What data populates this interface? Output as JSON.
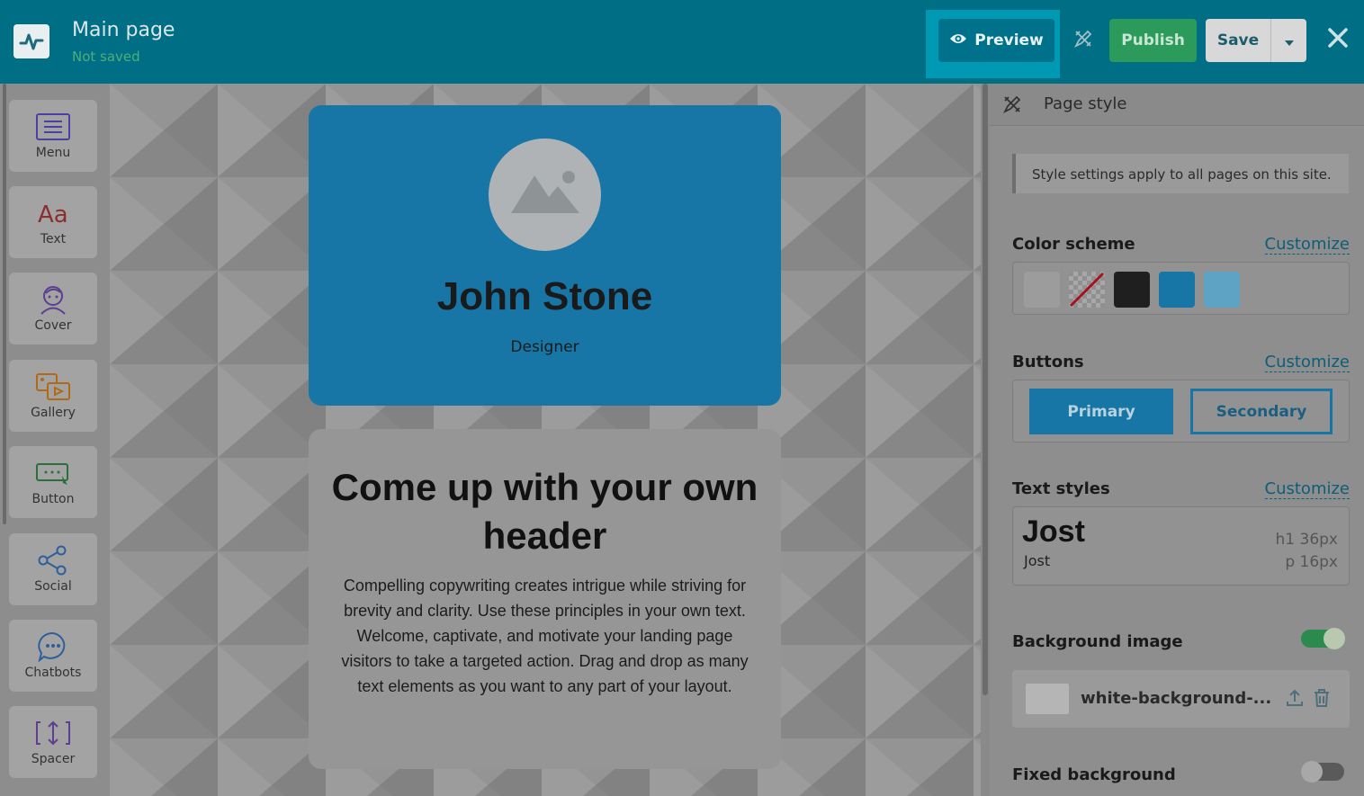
{
  "header": {
    "page_title": "Main page",
    "status": "Not saved",
    "preview_label": "Preview",
    "publish_label": "Publish",
    "save_label": "Save"
  },
  "toolbar": {
    "items": [
      {
        "label": "Menu",
        "icon": "menu-icon"
      },
      {
        "label": "Text",
        "icon": "text-icon"
      },
      {
        "label": "Cover",
        "icon": "cover-icon"
      },
      {
        "label": "Gallery",
        "icon": "gallery-icon"
      },
      {
        "label": "Button",
        "icon": "button-icon"
      },
      {
        "label": "Social",
        "icon": "social-icon"
      },
      {
        "label": "Chatbots",
        "icon": "chatbots-icon"
      },
      {
        "label": "Spacer",
        "icon": "spacer-icon"
      }
    ]
  },
  "canvas": {
    "hero": {
      "name": "John Stone",
      "role": "Designer"
    },
    "text_block": {
      "header": "Come up with your own header",
      "body": "Compelling copywriting creates intrigue while striving for brevity and clarity. Use these principles in your own text. Welcome, captivate, and motivate your landing page visitors to take a targeted action. Drag and drop as many text elements as you want to any part of your layout."
    }
  },
  "panel": {
    "title": "Page style",
    "info": "Style settings apply to all pages on this site.",
    "color_scheme": {
      "title": "Color scheme",
      "customize": "Customize",
      "swatches": [
        "#d6d6d6",
        "transparent",
        "#1f1f1f",
        "#1776a6",
        "#5fa3c4"
      ]
    },
    "buttons": {
      "title": "Buttons",
      "customize": "Customize",
      "primary": "Primary",
      "secondary": "Secondary"
    },
    "text_styles": {
      "title": "Text styles",
      "customize": "Customize",
      "heading_font": "Jost",
      "body_font": "Jost",
      "h1": "h1  36px",
      "p": "p  16px"
    },
    "background_image": {
      "title": "Background image",
      "enabled": true,
      "file_name": "white-background-..."
    },
    "fixed_background": {
      "title": "Fixed background",
      "enabled": false
    }
  },
  "colors": {
    "topbar": "#006f86",
    "accent": "#1776a6",
    "publish": "#2b9a5a"
  }
}
